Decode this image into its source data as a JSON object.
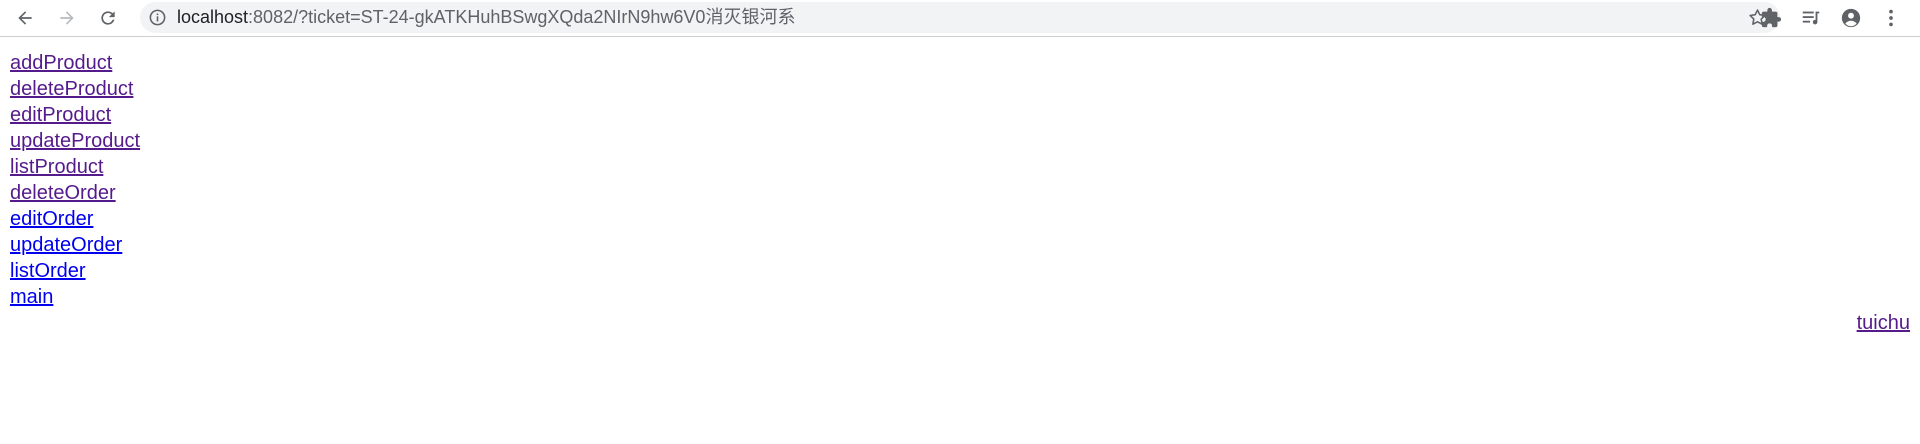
{
  "browser": {
    "url_host": "localhost",
    "url_rest": ":8082/?ticket=ST-24-gkATKHuhBSwgXQda2NIrN9hw6V0消灭银河系",
    "icons": {
      "back": "arrow-left-icon",
      "forward": "arrow-right-icon",
      "reload": "reload-icon",
      "info": "info-icon",
      "bookmark": "star-icon",
      "extensions": "puzzle-icon",
      "media": "media-queue-icon",
      "profile": "account-circle-icon",
      "menu": "kebab-menu-icon"
    }
  },
  "links": [
    {
      "label": "addProduct",
      "visited": true
    },
    {
      "label": "deleteProduct",
      "visited": true
    },
    {
      "label": "editProduct",
      "visited": true
    },
    {
      "label": "updateProduct",
      "visited": true
    },
    {
      "label": "listProduct",
      "visited": true
    },
    {
      "label": "deleteOrder",
      "visited": true
    },
    {
      "label": "editOrder",
      "visited": false
    },
    {
      "label": "updateOrder",
      "visited": false
    },
    {
      "label": "listOrder",
      "visited": false
    },
    {
      "label": "main",
      "visited": false
    }
  ],
  "logout": {
    "label": "tuichu"
  },
  "colors": {
    "link": "#0000ee",
    "visited": "#551a8b",
    "toolbar_bg": "#ffffff",
    "omnibox_bg": "#f1f3f4"
  }
}
